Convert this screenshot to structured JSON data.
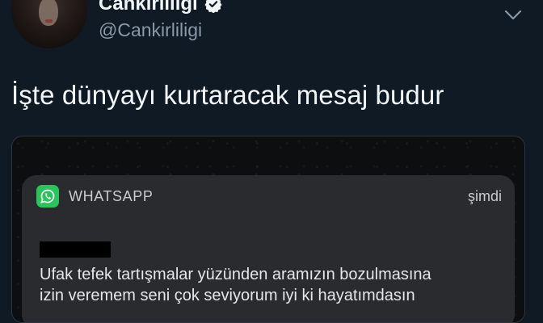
{
  "tweet": {
    "display_name": "Cankirliligi",
    "handle": "@Cankirliligi",
    "text": "İşte dünyayı kurtaracak mesaj budur",
    "verified_icon": "verified-badge-icon",
    "menu_icon": "chevron-down-icon"
  },
  "notification": {
    "app_name": "WHATSAPP",
    "time": "şimdi",
    "sender_redacted": true,
    "message_line1": "Ufak tefek tartışmalar yüzünden aramızın bozulmasına",
    "message_line2": "izin veremem seni çok seviyorum iyi ki hayatımdasın",
    "app_icon": "whatsapp-icon",
    "accent_color": "#29c45a"
  },
  "colors": {
    "background": "#0f1a24",
    "text_primary": "#f3f6f8",
    "text_secondary": "#8b98a5"
  }
}
